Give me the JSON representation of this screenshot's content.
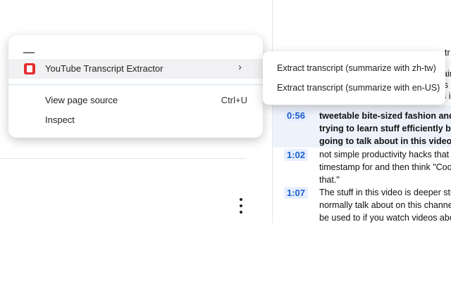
{
  "context_menu": {
    "extension_item": {
      "label": "YouTube Transcript Extractor",
      "arrow": "›"
    },
    "view_source": {
      "label": "View page source",
      "shortcut": "Ctrl+U"
    },
    "inspect": {
      "label": "Inspect"
    }
  },
  "submenu": {
    "items": [
      {
        "label": "Extract transcript (summarize with zh-tw)"
      },
      {
        "label": "Extract transcript (summarize with en-US)"
      }
    ]
  },
  "transcript": {
    "partial_top": [
      "tr",
      "ain",
      "s i",
      "is"
    ],
    "rows": [
      {
        "time": "0:56",
        "lines": [
          "tweetable bite-sized fashion and I g",
          "trying to learn stuff efficiently but t",
          "going to talk about in this video are"
        ]
      },
      {
        "time": "1:02",
        "lines": [
          "not simple productivity hacks that y",
          "timestamp for and then think \"Cool",
          "that.\""
        ]
      },
      {
        "time": "1:07",
        "lines": [
          "The stuff in this video is deeper stu",
          "normally talk about on this channe",
          "be used to if you watch videos abo"
        ]
      }
    ]
  }
}
